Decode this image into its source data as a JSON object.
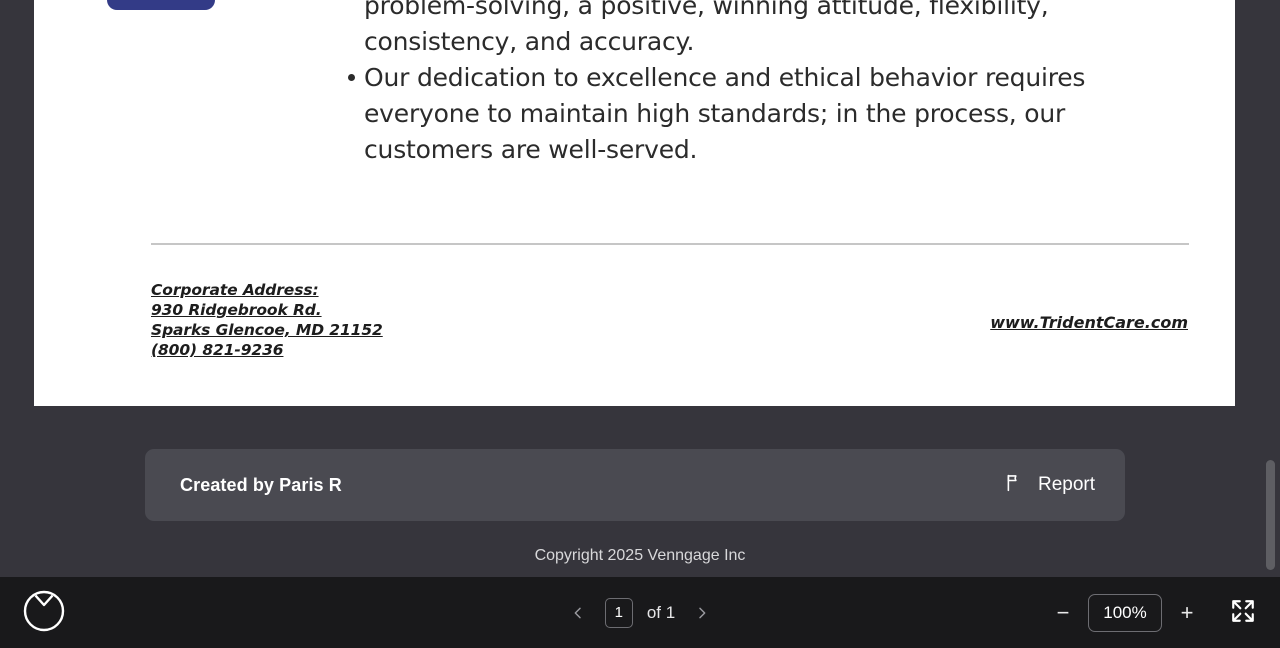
{
  "document": {
    "bullets": [
      {
        "marker": false,
        "text": "demonstrating growth and financial responsibility, creative problem-solving, a positive, winning attitude, flexibility, consistency, and accuracy."
      },
      {
        "marker": true,
        "text": "Our dedication to excellence and ethical behavior requires everyone to maintain high standards; in the process, our customers are well-served."
      }
    ],
    "footer": {
      "address_lines": [
        "Corporate Address:",
        "930 Ridgebrook Rd.",
        "Sparks Glencoe, MD 21152",
        "(800) 821-9236"
      ],
      "website": "www.TridentCare.com"
    },
    "accent_color": "#333b87"
  },
  "attribution": {
    "creator_label": "Created by Paris R",
    "report_label": "Report",
    "report_icon": "flag-icon",
    "background_color": "#4a4a51"
  },
  "copyright": "Copyright 2025 Venngage Inc",
  "toolbar": {
    "logo_icon": "venngage-logo-icon",
    "prev_page_icon": "chevron-left-icon",
    "next_page_icon": "chevron-right-icon",
    "current_page": "1",
    "page_of_label": "of 1",
    "zoom_out_label": "−",
    "zoom_level": "100%",
    "zoom_in_label": "+",
    "fullscreen_icon": "expand-icon",
    "background_color": "#19191b"
  }
}
